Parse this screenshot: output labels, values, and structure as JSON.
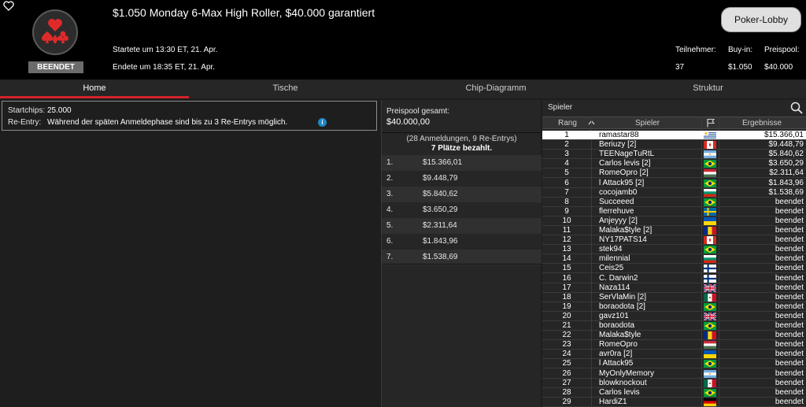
{
  "header": {
    "title": "$1.050 Monday 6-Max High Roller, $40.000 garantiert",
    "status": "BEENDET",
    "started": "Startete um 13:30 ET, 21. Apr.",
    "ended": "Endete um 18:35 ET, 21. Apr.",
    "lobby_button": "Poker-Lobby",
    "stats": {
      "participants_label": "Teilnehmer:",
      "participants_value": "37",
      "buyin_label": "Buy-in:",
      "buyin_value": "$1.050",
      "prizepool_label": "Preispool:",
      "prizepool_value": "$40.000"
    },
    "icons": {
      "favorite": "heart-outline-icon",
      "logo": "card-suits-icon"
    }
  },
  "tabs": [
    "Home",
    "Tische",
    "Chip-Diagramm",
    "Struktur"
  ],
  "active_tab": "Home",
  "home": {
    "startchips_label": "Startchips:",
    "startchips_value": "25.000",
    "reentry_label": "Re-Entry:",
    "reentry_value": "Während der späten Anmeldephase sind bis zu 3 Re-Entrys möglich."
  },
  "prizepool": {
    "label": "Preispool gesamt:",
    "value": "$40.000,00",
    "info1": "(28 Anmeldungen, 9 Re-Entrys)",
    "info2": "7 Plätze bezahlt.",
    "payouts": [
      {
        "place": "1.",
        "amount": "$15.366,01"
      },
      {
        "place": "2.",
        "amount": "$9.448,79"
      },
      {
        "place": "3.",
        "amount": "$5.840,62"
      },
      {
        "place": "4.",
        "amount": "$3.650,29"
      },
      {
        "place": "5.",
        "amount": "$2.311,64"
      },
      {
        "place": "6.",
        "amount": "$1.843,96"
      },
      {
        "place": "7.",
        "amount": "$1.538,69"
      }
    ]
  },
  "players": {
    "title": "Spieler",
    "columns": {
      "rank": "Rang",
      "player": "Spieler",
      "result": "Ergebnisse"
    },
    "rows": [
      {
        "rank": "1",
        "name": "ramastar88",
        "flag": "uruguay",
        "result": "$15.366,01"
      },
      {
        "rank": "2",
        "name": "Beriuzy [2]",
        "flag": "canada",
        "result": "$9.448,79"
      },
      {
        "rank": "3",
        "name": "TEENageTuRtL",
        "flag": "argentina",
        "result": "$5.840,62"
      },
      {
        "rank": "4",
        "name": "Carlos levis [2]",
        "flag": "brazil",
        "result": "$3.650,29"
      },
      {
        "rank": "5",
        "name": "RomeOpro [2]",
        "flag": "hungary",
        "result": "$2.311,64"
      },
      {
        "rank": "6",
        "name": "l Attack95 [2]",
        "flag": "brazil",
        "result": "$1.843,96"
      },
      {
        "rank": "7",
        "name": "cocojamb0",
        "flag": "bulgaria",
        "result": "$1.538,69"
      },
      {
        "rank": "8",
        "name": "Succeeed",
        "flag": "brazil",
        "result": "beendet"
      },
      {
        "rank": "9",
        "name": "flerrehuve",
        "flag": "sweden",
        "result": "beendet"
      },
      {
        "rank": "10",
        "name": "Anjeyyy [2]",
        "flag": "ukraine",
        "result": "beendet"
      },
      {
        "rank": "11",
        "name": "Malaka$tyle [2]",
        "flag": "romania",
        "result": "beendet"
      },
      {
        "rank": "12",
        "name": "NY17PATS14",
        "flag": "canada",
        "result": "beendet"
      },
      {
        "rank": "13",
        "name": "stek94",
        "flag": "brazil",
        "result": "beendet"
      },
      {
        "rank": "14",
        "name": "milennial",
        "flag": "bulgaria",
        "result": "beendet"
      },
      {
        "rank": "15",
        "name": "Ceis25",
        "flag": "finland",
        "result": "beendet"
      },
      {
        "rank": "16",
        "name": "C. Darwin2",
        "flag": "finland",
        "result": "beendet"
      },
      {
        "rank": "17",
        "name": "Naza114",
        "flag": "uk",
        "result": "beendet"
      },
      {
        "rank": "18",
        "name": "SerVlaMin [2]",
        "flag": "mexico",
        "result": "beendet"
      },
      {
        "rank": "19",
        "name": "boraodota [2]",
        "flag": "brazil",
        "result": "beendet"
      },
      {
        "rank": "20",
        "name": "gavz101",
        "flag": "uk",
        "result": "beendet"
      },
      {
        "rank": "21",
        "name": "boraodota",
        "flag": "brazil",
        "result": "beendet"
      },
      {
        "rank": "22",
        "name": "Malaka$tyle",
        "flag": "romania",
        "result": "beendet"
      },
      {
        "rank": "23",
        "name": "RomeOpro",
        "flag": "hungary",
        "result": "beendet"
      },
      {
        "rank": "24",
        "name": "avr0ra [2]",
        "flag": "ukraine",
        "result": "beendet"
      },
      {
        "rank": "25",
        "name": "l Attack95",
        "flag": "brazil",
        "result": "beendet"
      },
      {
        "rank": "26",
        "name": "MyOnlyMemory",
        "flag": "argentina",
        "result": "beendet"
      },
      {
        "rank": "27",
        "name": "blowknockout",
        "flag": "mexico",
        "result": "beendet"
      },
      {
        "rank": "28",
        "name": "Carlos levis",
        "flag": "brazil",
        "result": "beendet"
      },
      {
        "rank": "29",
        "name": "HardiZ1",
        "flag": "germany",
        "result": "beendet"
      }
    ]
  },
  "colors": {
    "accent": "#d3232a",
    "header_bg": "#000000",
    "panel_bg": "#262626",
    "page_bg": "#1e1e1e",
    "info_icon": "#1e88c8"
  }
}
